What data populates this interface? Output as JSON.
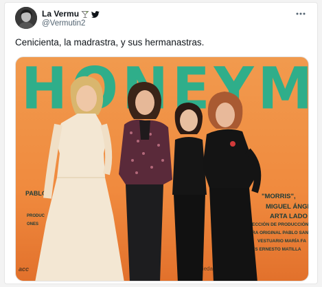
{
  "tweet": {
    "display_name": "La Vermu",
    "emoji_icon": "cocktail-glass-emoji",
    "platform_icon": "twitter-bird-icon",
    "handle": "@Vermutin2",
    "more_icon": "more-horizontal-icon",
    "text": "Cenicienta, la madrastra, y sus hermanastras."
  },
  "media": {
    "poster_title": "HONEYMOO",
    "credits_right": [
      "\"MORRIS\",",
      "MIGUEL ÁNGEL",
      "ARTA LADO",
      "ECCIÓN DE PRODUCCIÓN",
      "RA ORIGINAL PABLO SAN",
      "VESTUARIO MARÍA FA",
      "ES ERNESTO MATILLA"
    ],
    "credits_left": [
      "PABLO",
      "PRODUC",
      "ONES"
    ],
    "credits_bottom": [
      "acc",
      "Sociedad"
    ]
  },
  "colors": {
    "poster_orange": "#f08a3e",
    "poster_title_green": "#2fae8a",
    "twitter_blue": "#1d9bf0"
  }
}
